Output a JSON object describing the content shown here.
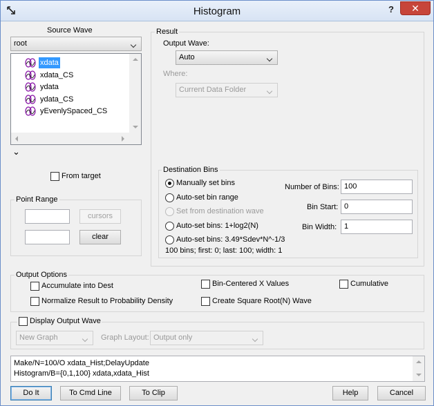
{
  "window": {
    "title": "Histogram",
    "help_glyph": "?",
    "close_glyph": "✕"
  },
  "source": {
    "title": "Source Wave",
    "folder": "root",
    "waves": [
      "xdata",
      "xdata_CS",
      "ydata",
      "ydata_CS",
      "yEvenlySpaced_CS"
    ],
    "selected_index": 0,
    "expand_glyph": "⌄",
    "from_target_label": "From target"
  },
  "point_range": {
    "title": "Point Range",
    "start_value": "",
    "end_value": "",
    "cursors_label": "cursors",
    "clear_label": "clear"
  },
  "result": {
    "title": "Result",
    "output_wave_label": "Output Wave:",
    "output_wave_value": "Auto",
    "where_label": "Where:",
    "where_value": "Current Data Folder"
  },
  "bins": {
    "title": "Destination Bins",
    "options": [
      "Manually set bins",
      "Auto-set bin range",
      "Set from destination wave",
      "Auto-set bins: 1+log2(N)",
      "Auto-set bins: 3.49*Sdev*N^-1/3"
    ],
    "selected_index": 0,
    "summary": "100 bins; first: 0; last: 100; width: 1",
    "num_bins_label": "Number of Bins:",
    "num_bins_value": "100",
    "bin_start_label": "Bin Start:",
    "bin_start_value": "0",
    "bin_width_label": "Bin Width:",
    "bin_width_value": "1"
  },
  "output_options": {
    "title": "Output Options",
    "accumulate": "Accumulate into Dest",
    "normalize": "Normalize Result to Probability Density",
    "bin_centered": "Bin-Centered X Values",
    "square_root": "Create Square Root(N) Wave",
    "cumulative": "Cumulative"
  },
  "display": {
    "label": "Display Output Wave",
    "graph_value": "New Graph",
    "layout_label": "Graph Layout:",
    "layout_value": "Output only"
  },
  "command": {
    "lines": [
      "Make/N=100/O xdata_Hist;DelayUpdate",
      "Histogram/B={0,1,100} xdata,xdata_Hist"
    ]
  },
  "buttons": {
    "do_it": "Do It",
    "to_cmd": "To Cmd Line",
    "to_clip": "To Clip",
    "help": "Help",
    "cancel": "Cancel"
  },
  "colors": {
    "selection": "#3399ff",
    "wave_icon": "#8a1aa8"
  }
}
